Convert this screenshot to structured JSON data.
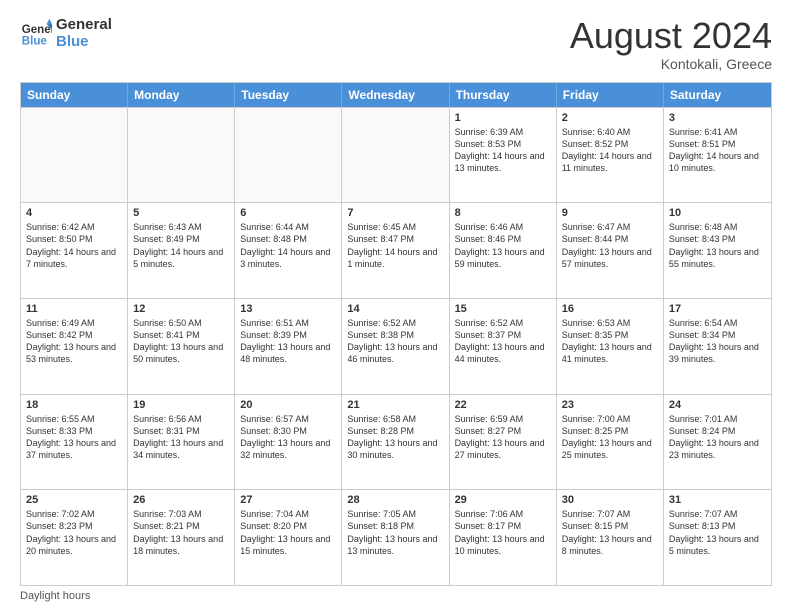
{
  "logo": {
    "line1": "General",
    "line2": "Blue"
  },
  "title": "August 2024",
  "subtitle": "Kontokali, Greece",
  "days": [
    "Sunday",
    "Monday",
    "Tuesday",
    "Wednesday",
    "Thursday",
    "Friday",
    "Saturday"
  ],
  "weeks": [
    [
      {
        "day": "",
        "sunrise": "",
        "sunset": "",
        "daylight": "",
        "empty": true
      },
      {
        "day": "",
        "sunrise": "",
        "sunset": "",
        "daylight": "",
        "empty": true
      },
      {
        "day": "",
        "sunrise": "",
        "sunset": "",
        "daylight": "",
        "empty": true
      },
      {
        "day": "",
        "sunrise": "",
        "sunset": "",
        "daylight": "",
        "empty": true
      },
      {
        "day": "1",
        "sunrise": "Sunrise: 6:39 AM",
        "sunset": "Sunset: 8:53 PM",
        "daylight": "Daylight: 14 hours and 13 minutes.",
        "empty": false
      },
      {
        "day": "2",
        "sunrise": "Sunrise: 6:40 AM",
        "sunset": "Sunset: 8:52 PM",
        "daylight": "Daylight: 14 hours and 11 minutes.",
        "empty": false
      },
      {
        "day": "3",
        "sunrise": "Sunrise: 6:41 AM",
        "sunset": "Sunset: 8:51 PM",
        "daylight": "Daylight: 14 hours and 10 minutes.",
        "empty": false
      }
    ],
    [
      {
        "day": "4",
        "sunrise": "Sunrise: 6:42 AM",
        "sunset": "Sunset: 8:50 PM",
        "daylight": "Daylight: 14 hours and 7 minutes.",
        "empty": false
      },
      {
        "day": "5",
        "sunrise": "Sunrise: 6:43 AM",
        "sunset": "Sunset: 8:49 PM",
        "daylight": "Daylight: 14 hours and 5 minutes.",
        "empty": false
      },
      {
        "day": "6",
        "sunrise": "Sunrise: 6:44 AM",
        "sunset": "Sunset: 8:48 PM",
        "daylight": "Daylight: 14 hours and 3 minutes.",
        "empty": false
      },
      {
        "day": "7",
        "sunrise": "Sunrise: 6:45 AM",
        "sunset": "Sunset: 8:47 PM",
        "daylight": "Daylight: 14 hours and 1 minute.",
        "empty": false
      },
      {
        "day": "8",
        "sunrise": "Sunrise: 6:46 AM",
        "sunset": "Sunset: 8:46 PM",
        "daylight": "Daylight: 13 hours and 59 minutes.",
        "empty": false
      },
      {
        "day": "9",
        "sunrise": "Sunrise: 6:47 AM",
        "sunset": "Sunset: 8:44 PM",
        "daylight": "Daylight: 13 hours and 57 minutes.",
        "empty": false
      },
      {
        "day": "10",
        "sunrise": "Sunrise: 6:48 AM",
        "sunset": "Sunset: 8:43 PM",
        "daylight": "Daylight: 13 hours and 55 minutes.",
        "empty": false
      }
    ],
    [
      {
        "day": "11",
        "sunrise": "Sunrise: 6:49 AM",
        "sunset": "Sunset: 8:42 PM",
        "daylight": "Daylight: 13 hours and 53 minutes.",
        "empty": false
      },
      {
        "day": "12",
        "sunrise": "Sunrise: 6:50 AM",
        "sunset": "Sunset: 8:41 PM",
        "daylight": "Daylight: 13 hours and 50 minutes.",
        "empty": false
      },
      {
        "day": "13",
        "sunrise": "Sunrise: 6:51 AM",
        "sunset": "Sunset: 8:39 PM",
        "daylight": "Daylight: 13 hours and 48 minutes.",
        "empty": false
      },
      {
        "day": "14",
        "sunrise": "Sunrise: 6:52 AM",
        "sunset": "Sunset: 8:38 PM",
        "daylight": "Daylight: 13 hours and 46 minutes.",
        "empty": false
      },
      {
        "day": "15",
        "sunrise": "Sunrise: 6:52 AM",
        "sunset": "Sunset: 8:37 PM",
        "daylight": "Daylight: 13 hours and 44 minutes.",
        "empty": false
      },
      {
        "day": "16",
        "sunrise": "Sunrise: 6:53 AM",
        "sunset": "Sunset: 8:35 PM",
        "daylight": "Daylight: 13 hours and 41 minutes.",
        "empty": false
      },
      {
        "day": "17",
        "sunrise": "Sunrise: 6:54 AM",
        "sunset": "Sunset: 8:34 PM",
        "daylight": "Daylight: 13 hours and 39 minutes.",
        "empty": false
      }
    ],
    [
      {
        "day": "18",
        "sunrise": "Sunrise: 6:55 AM",
        "sunset": "Sunset: 8:33 PM",
        "daylight": "Daylight: 13 hours and 37 minutes.",
        "empty": false
      },
      {
        "day": "19",
        "sunrise": "Sunrise: 6:56 AM",
        "sunset": "Sunset: 8:31 PM",
        "daylight": "Daylight: 13 hours and 34 minutes.",
        "empty": false
      },
      {
        "day": "20",
        "sunrise": "Sunrise: 6:57 AM",
        "sunset": "Sunset: 8:30 PM",
        "daylight": "Daylight: 13 hours and 32 minutes.",
        "empty": false
      },
      {
        "day": "21",
        "sunrise": "Sunrise: 6:58 AM",
        "sunset": "Sunset: 8:28 PM",
        "daylight": "Daylight: 13 hours and 30 minutes.",
        "empty": false
      },
      {
        "day": "22",
        "sunrise": "Sunrise: 6:59 AM",
        "sunset": "Sunset: 8:27 PM",
        "daylight": "Daylight: 13 hours and 27 minutes.",
        "empty": false
      },
      {
        "day": "23",
        "sunrise": "Sunrise: 7:00 AM",
        "sunset": "Sunset: 8:25 PM",
        "daylight": "Daylight: 13 hours and 25 minutes.",
        "empty": false
      },
      {
        "day": "24",
        "sunrise": "Sunrise: 7:01 AM",
        "sunset": "Sunset: 8:24 PM",
        "daylight": "Daylight: 13 hours and 23 minutes.",
        "empty": false
      }
    ],
    [
      {
        "day": "25",
        "sunrise": "Sunrise: 7:02 AM",
        "sunset": "Sunset: 8:23 PM",
        "daylight": "Daylight: 13 hours and 20 minutes.",
        "empty": false
      },
      {
        "day": "26",
        "sunrise": "Sunrise: 7:03 AM",
        "sunset": "Sunset: 8:21 PM",
        "daylight": "Daylight: 13 hours and 18 minutes.",
        "empty": false
      },
      {
        "day": "27",
        "sunrise": "Sunrise: 7:04 AM",
        "sunset": "Sunset: 8:20 PM",
        "daylight": "Daylight: 13 hours and 15 minutes.",
        "empty": false
      },
      {
        "day": "28",
        "sunrise": "Sunrise: 7:05 AM",
        "sunset": "Sunset: 8:18 PM",
        "daylight": "Daylight: 13 hours and 13 minutes.",
        "empty": false
      },
      {
        "day": "29",
        "sunrise": "Sunrise: 7:06 AM",
        "sunset": "Sunset: 8:17 PM",
        "daylight": "Daylight: 13 hours and 10 minutes.",
        "empty": false
      },
      {
        "day": "30",
        "sunrise": "Sunrise: 7:07 AM",
        "sunset": "Sunset: 8:15 PM",
        "daylight": "Daylight: 13 hours and 8 minutes.",
        "empty": false
      },
      {
        "day": "31",
        "sunrise": "Sunrise: 7:07 AM",
        "sunset": "Sunset: 8:13 PM",
        "daylight": "Daylight: 13 hours and 5 minutes.",
        "empty": false
      }
    ]
  ],
  "footer": "Daylight hours"
}
